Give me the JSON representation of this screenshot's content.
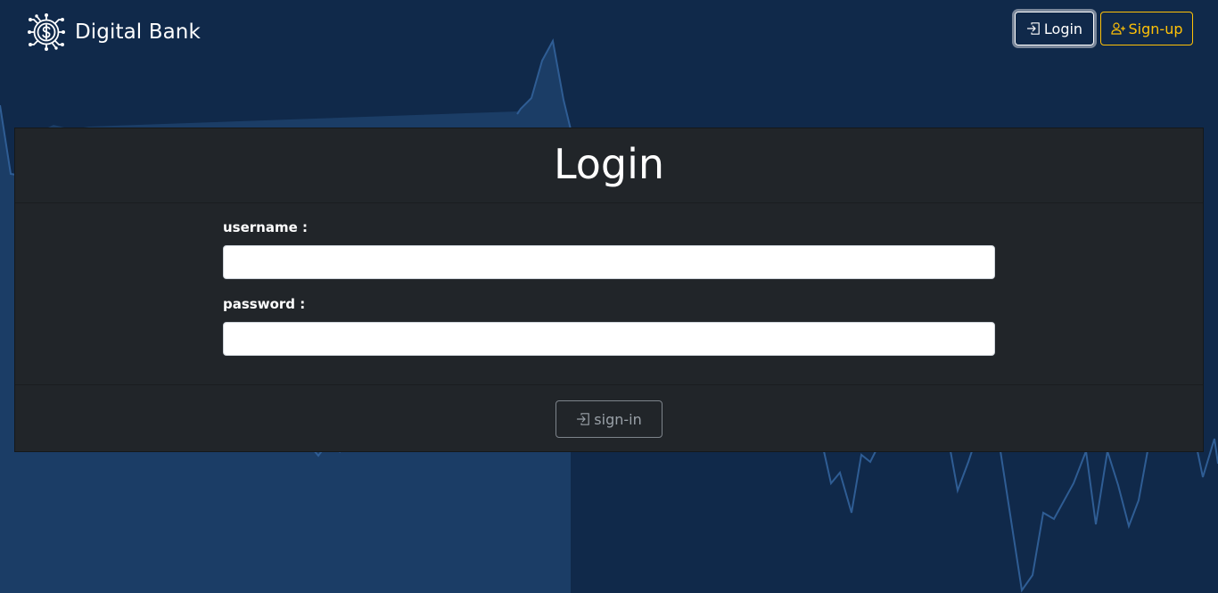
{
  "brand": {
    "name": "Digital Bank",
    "logo_icon": "dollar-circuit-icon"
  },
  "nav": {
    "login_label": "Login",
    "login_icon": "box-arrow-in-right-icon",
    "signup_label": "Sign-up",
    "signup_icon": "person-plus-icon"
  },
  "login_form": {
    "title": "Login",
    "username_label": "username :",
    "username_value": "",
    "password_label": "password :",
    "password_value": "",
    "submit_label": "sign-in",
    "submit_icon": "box-arrow-in-right-icon"
  },
  "colors": {
    "background": "#10294a",
    "card": "#212529",
    "accent_warning": "#ffc107",
    "chart_line": "#2f5d94",
    "chart_fill": "#1f4470"
  }
}
